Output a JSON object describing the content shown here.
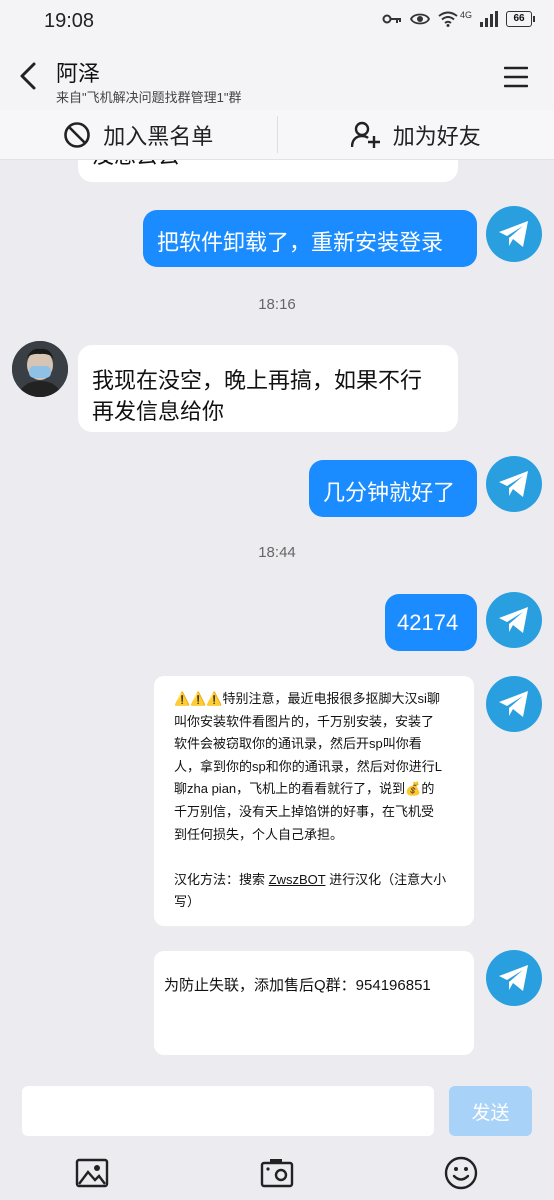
{
  "status": {
    "time": "19:08",
    "network": "4G",
    "battery": "66"
  },
  "header": {
    "title": "阿泽",
    "subtitle": "来自\"飞机解决问题找群管理1\"群"
  },
  "actions": {
    "block": "加入黑名单",
    "add_friend": "加为好友"
  },
  "messages": {
    "partial_in": "没想去去",
    "out1": "把软件卸载了，重新安装登录",
    "time1": "18:16",
    "in1_line1": "我现在没空，晚上再搞，如果不行",
    "in1_line2": "再发信息给你",
    "out2": "几分钟就好了",
    "time2": "18:44",
    "out3": "42174",
    "card1": {
      "line1": "⚠️⚠️⚠️特别注意，最近电报很多抠脚大汉si聊",
      "line2": "叫你安装软件看图片的，千万别安装，安装了",
      "line3": "软件会被窃取你的通讯录，然后开sp叫你看",
      "line4": "人，拿到你的sp和你的通讯录，然后对你进行L",
      "line5": "聊zha pian，飞机上的看看就行了，说到💰的",
      "line6": "千万别信，没有天上掉馅饼的好事，在飞机受",
      "line7": "到任何损失，个人自己承担。",
      "line8_pre": "汉化方法：搜索 ",
      "line8_link": "ZwszBOT",
      "line8_post": " 进行汉化（注意大小",
      "line9": "写）"
    },
    "card2": "为防止失联，添加售后Q群：954196851"
  },
  "input": {
    "value": "",
    "send": "发送"
  },
  "colors": {
    "accent": "#1a8cff",
    "telegram": "#2a9fe0",
    "send_disabled": "#a8d2f7"
  },
  "icons": [
    "back-arrow-icon",
    "menu-icon",
    "block-icon",
    "add-user-icon",
    "telegram-icon",
    "image-icon",
    "camera-icon",
    "emoji-icon"
  ]
}
